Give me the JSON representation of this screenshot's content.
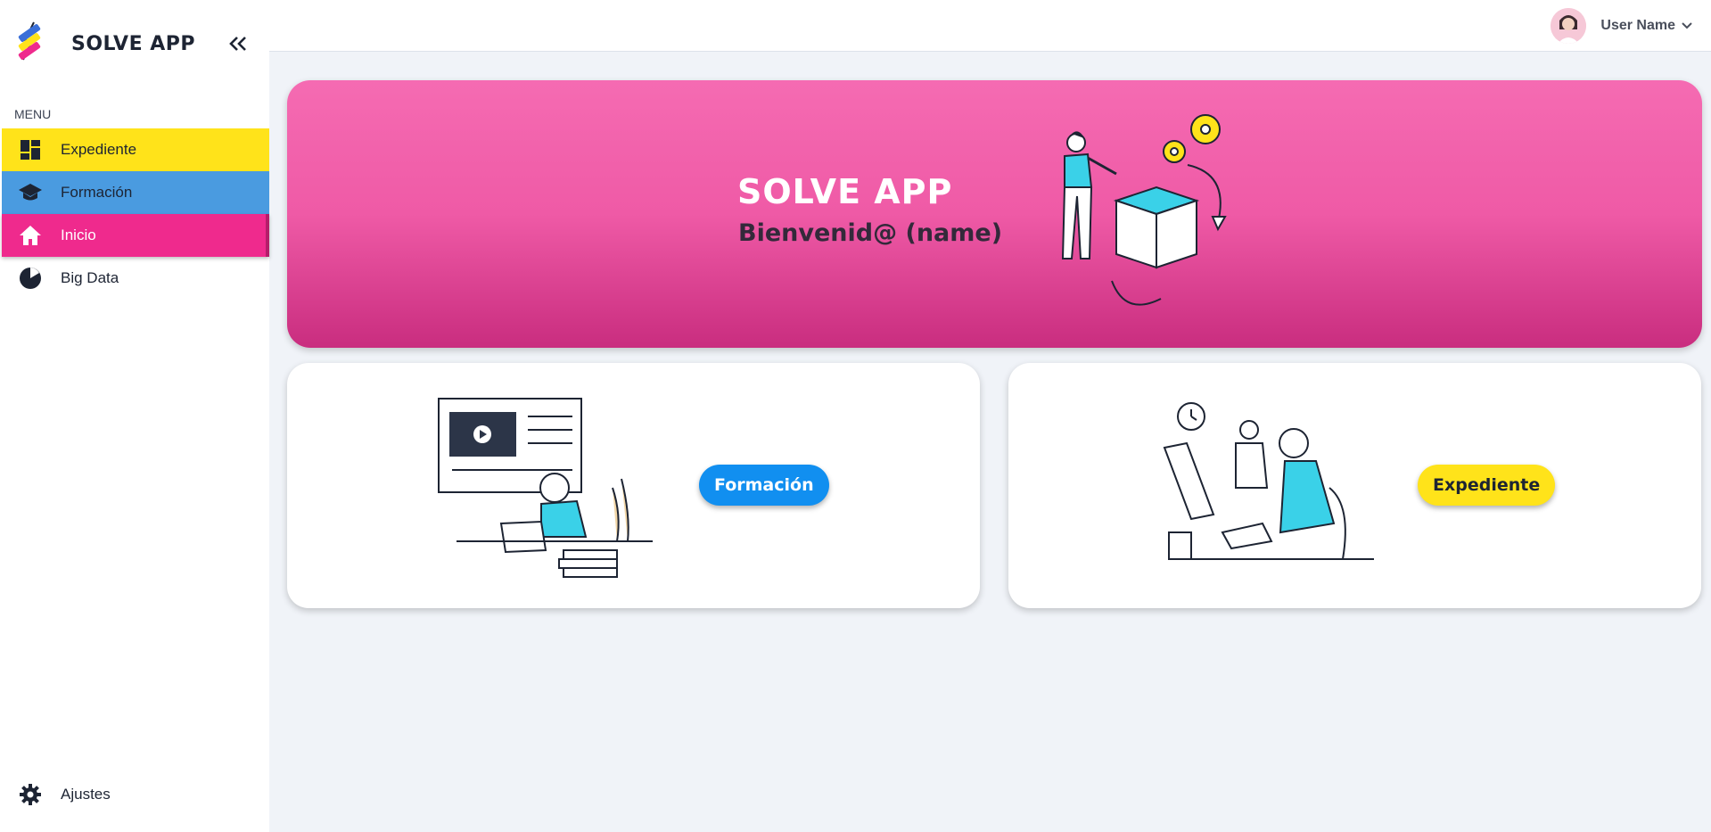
{
  "sidebar": {
    "app_name": "SOLVE APP",
    "menu_heading": "MENU",
    "items": [
      {
        "label": "Expediente",
        "icon": "dashboard-icon"
      },
      {
        "label": "Formación",
        "icon": "graduation-cap-icon"
      },
      {
        "label": "Inicio",
        "icon": "home-icon"
      },
      {
        "label": "Big Data",
        "icon": "pie-chart-icon"
      }
    ],
    "settings_label": "Ajustes"
  },
  "header": {
    "user_name": "User Name"
  },
  "hero": {
    "title": "SOLVE APP",
    "subtitle": "Bienvenid@ (name)"
  },
  "cards": [
    {
      "button_label": "Formación"
    },
    {
      "button_label": "Expediente"
    }
  ],
  "colors": {
    "yellow": "#ffe31a",
    "blue": "#4a9be0",
    "pink": "#ef2a8d",
    "button_blue": "#118ff0"
  }
}
